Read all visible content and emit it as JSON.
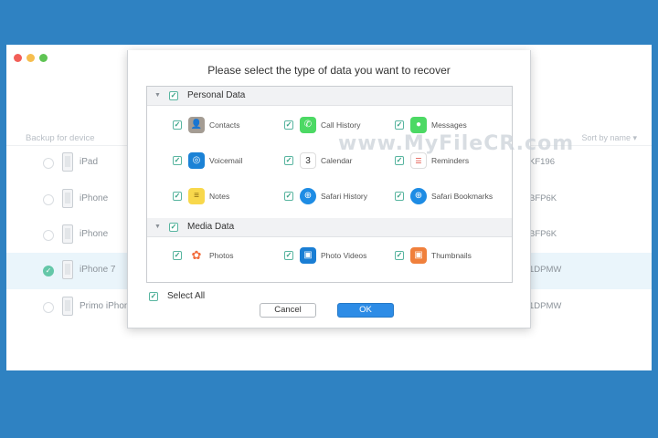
{
  "background": {
    "frame_color": "#2f82c2"
  },
  "app": {
    "list_header_left": "Backup for device",
    "list_header_right": "Sort by name ▾",
    "devices": [
      {
        "name": "iPad",
        "code": "KF196",
        "selected": false
      },
      {
        "name": "iPhone",
        "code": "BFP6K",
        "selected": false
      },
      {
        "name": "iPhone",
        "code": "BFP6K",
        "selected": false
      },
      {
        "name": "iPhone 7",
        "code": "1DPMW",
        "selected": true
      },
      {
        "name": "Primo iPhone",
        "code": "1DPMW",
        "selected": false
      }
    ]
  },
  "dialog": {
    "title": "Please select the type of data you want to recover",
    "sections": [
      {
        "label": "Personal Data",
        "checked": true,
        "items": [
          {
            "label": "Contacts",
            "icon": "contacts-icon",
            "checked": true
          },
          {
            "label": "Call History",
            "icon": "phone-icon",
            "checked": true
          },
          {
            "label": "Messages",
            "icon": "message-bubble-icon",
            "checked": true
          },
          {
            "label": "Voicemail",
            "icon": "voicemail-icon",
            "checked": true
          },
          {
            "label": "Calendar",
            "icon": "calendar-icon",
            "checked": true,
            "icon_text": "3"
          },
          {
            "label": "Reminders",
            "icon": "reminders-icon",
            "checked": true
          },
          {
            "label": "Notes",
            "icon": "notes-icon",
            "checked": true
          },
          {
            "label": "Safari History",
            "icon": "safari-history-icon",
            "checked": true
          },
          {
            "label": "Safari Bookmarks",
            "icon": "safari-bookmarks-icon",
            "checked": true
          }
        ]
      },
      {
        "label": "Media Data",
        "checked": true,
        "items": [
          {
            "label": "Photos",
            "icon": "photos-icon",
            "checked": true
          },
          {
            "label": "Photo Videos",
            "icon": "photo-videos-icon",
            "checked": true
          },
          {
            "label": "Thumbnails",
            "icon": "thumbnails-icon",
            "checked": true
          }
        ]
      }
    ],
    "select_all_label": "Select All",
    "select_all_checked": true,
    "cancel_label": "Cancel",
    "ok_label": "OK"
  },
  "watermark": {
    "text": "www.MyFileCR.com"
  },
  "colors": {
    "accent": "#2d8ce6",
    "check": "#34a083",
    "selected_row": "#eaf5fb"
  }
}
